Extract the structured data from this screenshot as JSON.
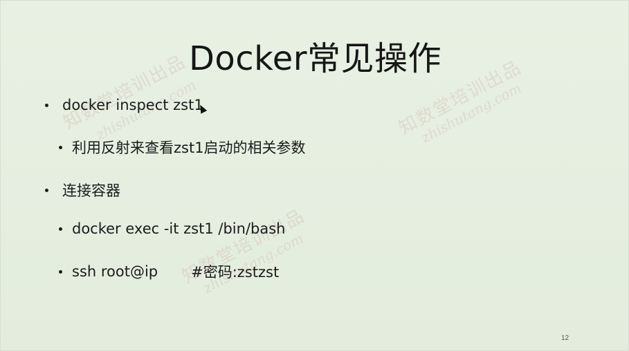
{
  "slide": {
    "title": "Docker常见操作",
    "bullets": [
      {
        "level": 1,
        "text": "docker inspect zst1"
      },
      {
        "level": 2,
        "text": "利用反射来查看zst1启动的相关参数"
      },
      {
        "level": 1,
        "text": "连接容器"
      },
      {
        "level": 2,
        "text": "docker exec -it zst1 /bin/bash"
      },
      {
        "level": 2,
        "text": "ssh root@ip",
        "comment": "#密码:zstzst"
      }
    ],
    "page_number": "12"
  },
  "watermark": {
    "cn": "知数堂培训出品",
    "en": "zhishutang.com",
    "color": "#b46e6e"
  },
  "icons": {
    "bullet": "bullet-dot-icon",
    "cursor": "mouse-pointer-icon"
  }
}
